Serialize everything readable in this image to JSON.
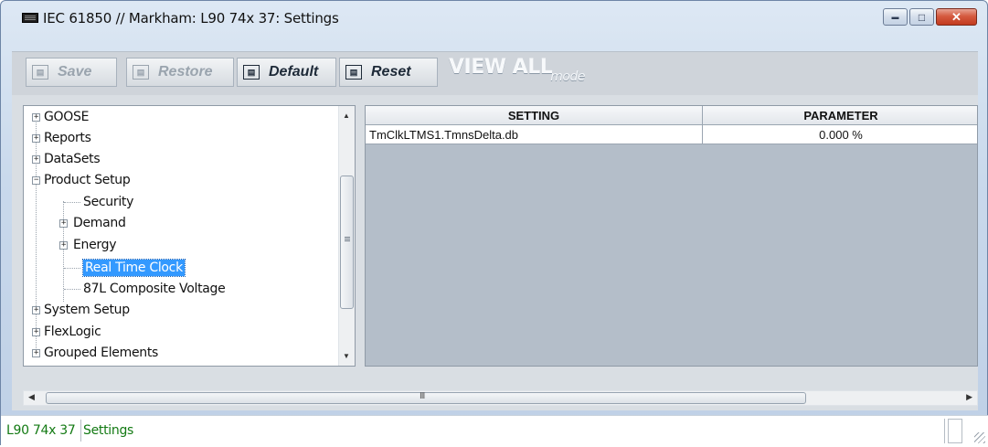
{
  "window": {
    "title": "IEC 61850 // Markham: L90 74x 37: Settings",
    "controls": {
      "minimize": "▬",
      "maximize": "□",
      "close": "✕"
    }
  },
  "toolbar": {
    "save_label": "Save",
    "restore_label": "Restore",
    "default_label": "Default",
    "reset_label": "Reset",
    "view_all": "VIEW ALL",
    "view_mode": "mode"
  },
  "tree": {
    "items": [
      {
        "label": "GOOSE",
        "expander": "+"
      },
      {
        "label": "Reports",
        "expander": "+"
      },
      {
        "label": "DataSets",
        "expander": "+"
      },
      {
        "label": "Product Setup",
        "expander": "−"
      },
      {
        "label": "Security"
      },
      {
        "label": "Demand",
        "expander": "+"
      },
      {
        "label": "Energy",
        "expander": "+"
      },
      {
        "label": "Real Time Clock",
        "selected": true
      },
      {
        "label": "87L Composite Voltage"
      },
      {
        "label": "System Setup",
        "expander": "+"
      },
      {
        "label": "FlexLogic",
        "expander": "+"
      },
      {
        "label": "Grouped Elements",
        "expander": "+"
      }
    ]
  },
  "grid": {
    "columns": [
      "SETTING",
      "PARAMETER"
    ],
    "rows": [
      {
        "setting": "TmClkLTMS1.TmnsDelta.db",
        "parameter": "0.000 %"
      }
    ]
  },
  "hscroll": {
    "grip": "III"
  },
  "statusbar": {
    "device": "L90 74x 37",
    "view": "Settings"
  },
  "colors": {
    "selection": "#3399ff",
    "status_text": "#137a13",
    "grid_background": "#b4bec9"
  }
}
